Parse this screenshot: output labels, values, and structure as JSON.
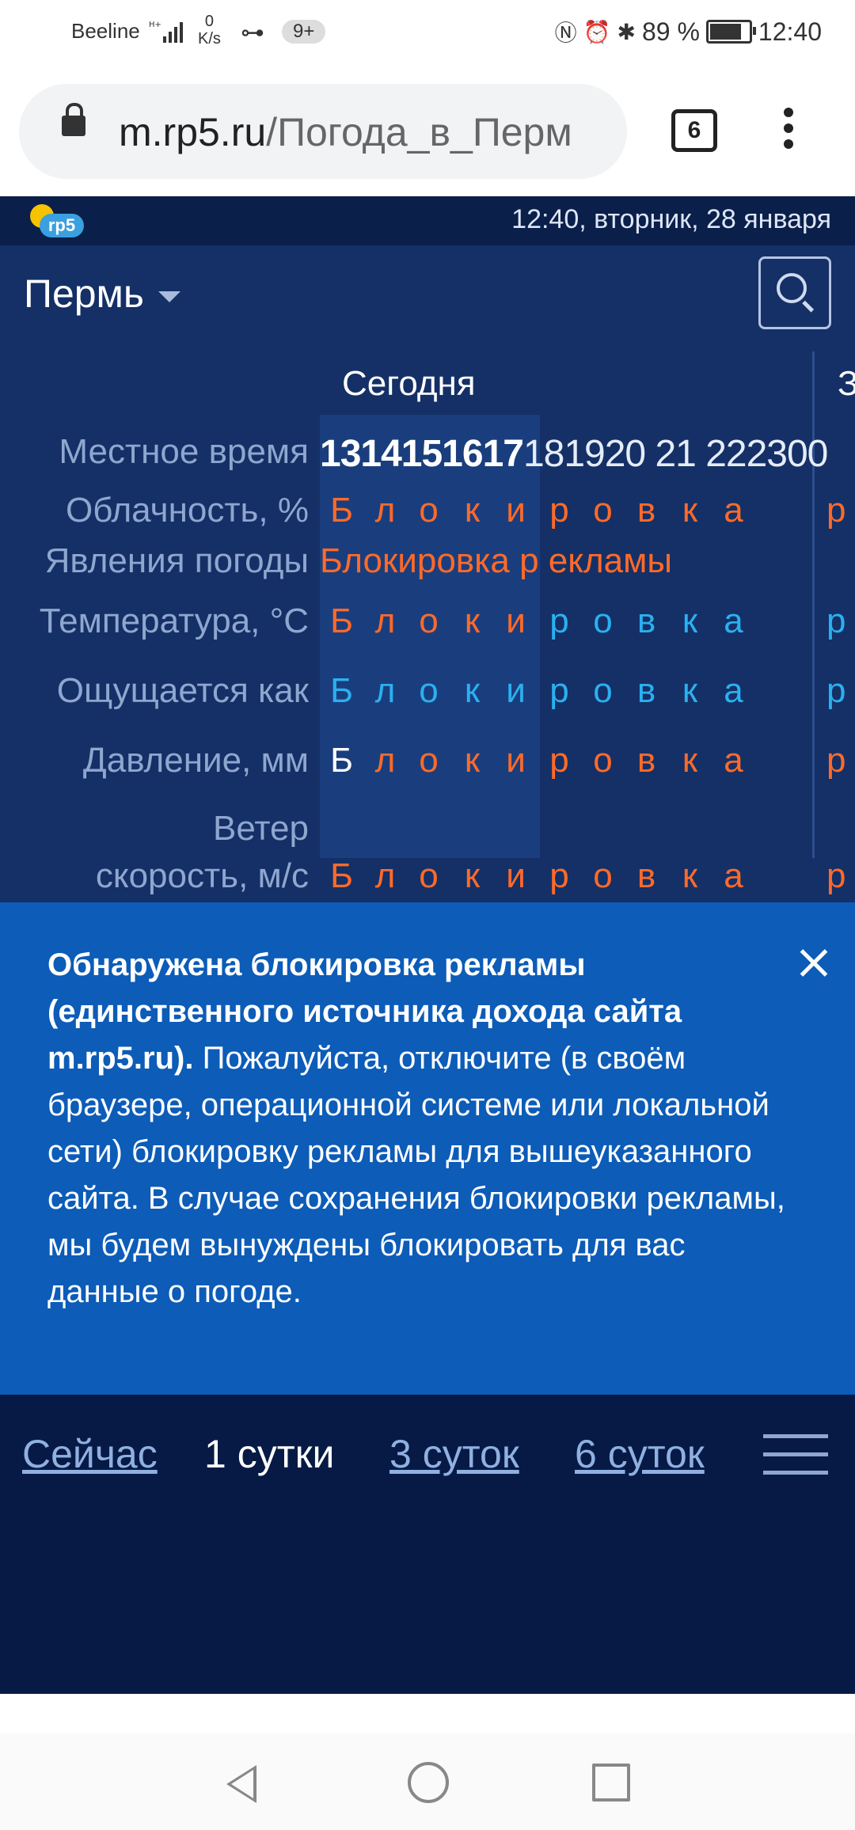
{
  "status_bar": {
    "carrier": "Beeline",
    "speed_value": "0",
    "speed_unit": "K/s",
    "notif_badge": "9+",
    "battery": "89 %",
    "battery_level": 0.89,
    "time": "12:40"
  },
  "browser": {
    "url_host": "m.rp5.ru",
    "url_path": "/Погода_в_Перм",
    "tab_count": "6"
  },
  "site": {
    "logo_text": "rp5",
    "datetime": "12:40, вторник, 28 января",
    "city": "Пермь",
    "day_label": "Сегодня",
    "next_day_label": "З",
    "hours_today": "1314151617",
    "hours_rest": "181920 21 222300",
    "rows": {
      "local_time": "Местное время",
      "cloudiness": "Облачность, %",
      "phenomena": "Явления погоды",
      "temperature": "Температура, °С",
      "feels_like": "Ощущается как",
      "pressure": "Давление, мм",
      "wind_1": "Ветер",
      "wind_2": "скорость, м/с"
    },
    "blocked_letters": [
      "Б",
      "л",
      "о",
      "к",
      "и",
      "р",
      "о",
      "в",
      "к",
      "а"
    ],
    "phenomena_text": "Блокировка р екламы",
    "edge_letter": "р",
    "colors": {
      "orange": "#ff6a2a",
      "blue": "#2bb0f0",
      "white": "#ffffff"
    }
  },
  "notice": {
    "bold": "Обнаружена блокировка рекламы (единственного источника дохода сайта m.rp5.ru).",
    "text": " Пожалуйста, отключите (в своём браузере, операционной системе или локальной сети) блокировку рекламы для вышеуказанного сайта. В случае сохранения блокировки рекламы, мы будем вынуждены блокировать для вас данные о погоде."
  },
  "bottom_nav": {
    "now": "Сейчас",
    "one_day": "1 сутки",
    "three_days": "3 суток",
    "six_days": "6 суток"
  }
}
